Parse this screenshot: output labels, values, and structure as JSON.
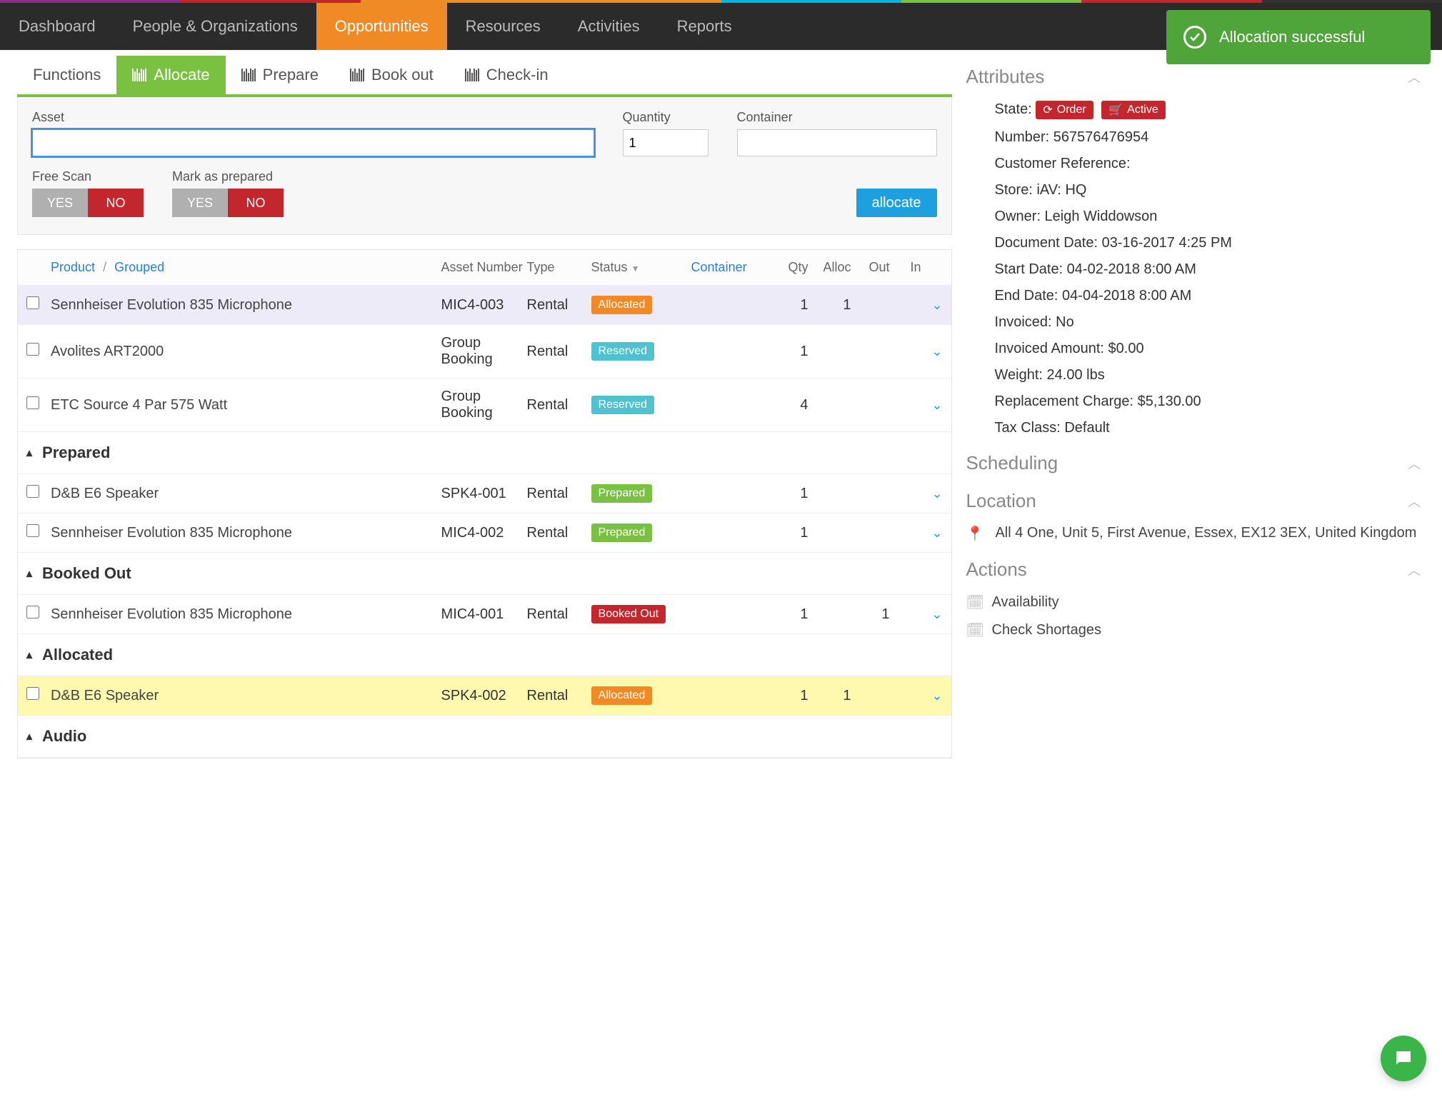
{
  "stripe": [
    "#8e2e8e",
    "#c1272d",
    "#f08a24",
    "#f08a24",
    "#00b5e2",
    "#7ac142",
    "#c1272d",
    "#333"
  ],
  "nav": {
    "items": [
      "Dashboard",
      "People & Organizations",
      "Opportunities",
      "Resources",
      "Activities",
      "Reports"
    ],
    "active": 2
  },
  "toast": {
    "text": "Allocation successful"
  },
  "subtabs": {
    "functions": "Functions",
    "allocate": "Allocate",
    "prepare": "Prepare",
    "bookout": "Book out",
    "checkin": "Check-in",
    "active": "allocate"
  },
  "form": {
    "asset_label": "Asset",
    "asset_value": "",
    "qty_label": "Quantity",
    "qty_value": "1",
    "container_label": "Container",
    "container_value": "",
    "freescan_label": "Free Scan",
    "markprep_label": "Mark as prepared",
    "yes": "YES",
    "no": "NO",
    "allocate": "allocate"
  },
  "table": {
    "headers": {
      "product": "Product",
      "grouped": "Grouped",
      "asset": "Asset Number",
      "type": "Type",
      "status": "Status",
      "container": "Container",
      "qty": "Qty",
      "alloc": "Alloc",
      "out": "Out",
      "in": "In"
    },
    "rows_top": [
      {
        "prod": "Sennheiser Evolution 835 Microphone",
        "asset": "MIC4-003",
        "type": "Rental",
        "status": "Allocated",
        "status_class": "b-allocated",
        "qty": "1",
        "alloc": "1",
        "sel": true
      },
      {
        "prod": "Avolites ART2000",
        "asset": "Group Booking",
        "type": "Rental",
        "status": "Reserved",
        "status_class": "b-reserved",
        "qty": "1"
      },
      {
        "prod": "ETC Source 4 Par 575 Watt",
        "asset": "Group Booking",
        "type": "Rental",
        "status": "Reserved",
        "status_class": "b-reserved",
        "qty": "4"
      }
    ],
    "sections": [
      {
        "title": "Prepared",
        "rows": [
          {
            "prod": "D&B E6 Speaker",
            "asset": "SPK4-001",
            "type": "Rental",
            "status": "Prepared",
            "status_class": "b-prepared",
            "qty": "1"
          },
          {
            "prod": "Sennheiser Evolution 835 Microphone",
            "asset": "MIC4-002",
            "type": "Rental",
            "status": "Prepared",
            "status_class": "b-prepared",
            "qty": "1"
          }
        ]
      },
      {
        "title": "Booked Out",
        "rows": [
          {
            "prod": "Sennheiser Evolution 835 Microphone",
            "asset": "MIC4-001",
            "type": "Rental",
            "status": "Booked Out",
            "status_class": "b-booked",
            "qty": "1",
            "out": "1"
          }
        ]
      },
      {
        "title": "Allocated",
        "rows": [
          {
            "prod": "D&B E6 Speaker",
            "asset": "SPK4-002",
            "type": "Rental",
            "status": "Allocated",
            "status_class": "b-allocated",
            "qty": "1",
            "alloc": "1",
            "hl": true
          }
        ]
      },
      {
        "title": "Audio",
        "rows": []
      }
    ]
  },
  "attributes": {
    "title": "Attributes",
    "state_label": "State:",
    "state_badges": [
      "Order",
      "Active"
    ],
    "items": [
      "Number: 567576476954",
      "Customer Reference:",
      "Store: iAV: HQ",
      "Owner: Leigh Widdowson",
      "Document Date: 03-16-2017 4:25 PM",
      "Start Date: 04-02-2018 8:00 AM",
      "End Date: 04-04-2018 8:00 AM",
      "Invoiced: No",
      "Invoiced Amount: $0.00",
      "Weight: 24.00 lbs",
      "Replacement Charge: $5,130.00",
      "Tax Class: Default"
    ]
  },
  "scheduling": {
    "title": "Scheduling"
  },
  "location": {
    "title": "Location",
    "text": "All 4 One, Unit 5, First Avenue, Essex, EX12 3EX, United Kingdom"
  },
  "actions": {
    "title": "Actions",
    "items": [
      "Availability",
      "Check Shortages"
    ]
  }
}
